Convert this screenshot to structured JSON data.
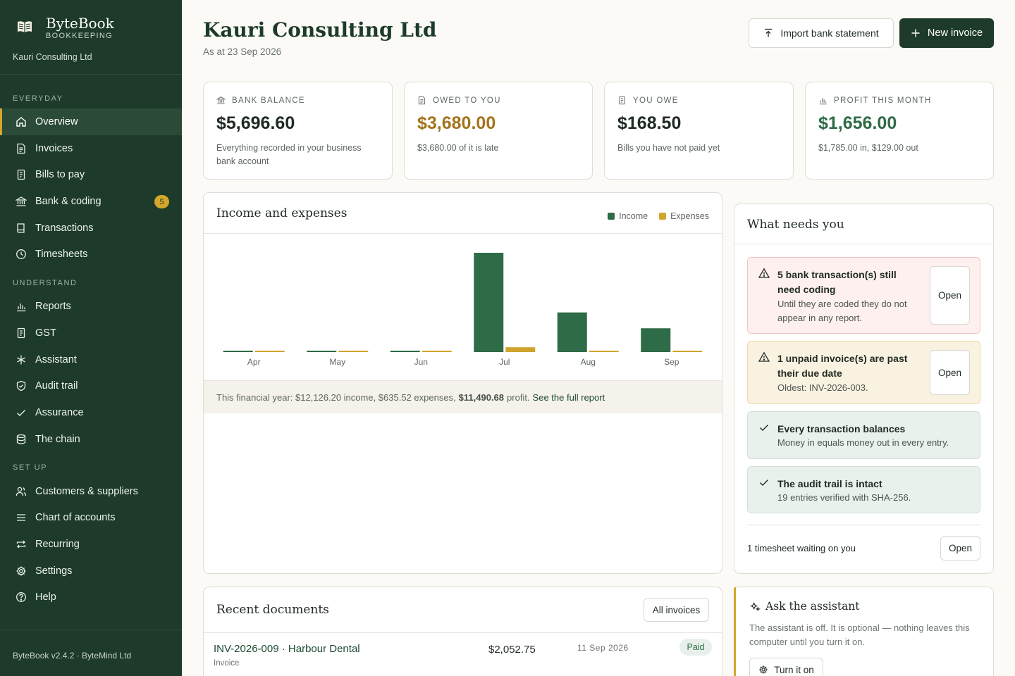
{
  "app": {
    "name": "ByteBook",
    "subtitle": "BOOKKEEPING",
    "company": "Kauri Consulting Ltd",
    "version": "ByteBook v2.4.2 · ByteMind Ltd"
  },
  "sidebar": {
    "sections": [
      {
        "label": "EVERYDAY",
        "items": [
          {
            "label": "Overview",
            "icon": "home-icon",
            "active": true
          },
          {
            "label": "Invoices",
            "icon": "document-icon"
          },
          {
            "label": "Bills to pay",
            "icon": "receipt-icon"
          },
          {
            "label": "Bank & coding",
            "icon": "bank-icon",
            "badge": "5"
          },
          {
            "label": "Transactions",
            "icon": "book-icon"
          },
          {
            "label": "Timesheets",
            "icon": "clock-icon"
          }
        ]
      },
      {
        "label": "UNDERSTAND",
        "items": [
          {
            "label": "Reports",
            "icon": "bar-chart-icon"
          },
          {
            "label": "GST",
            "icon": "receipt-icon"
          },
          {
            "label": "Assistant",
            "icon": "sparkle-icon"
          },
          {
            "label": "Audit trail",
            "icon": "shield-icon"
          },
          {
            "label": "Assurance",
            "icon": "check-icon"
          },
          {
            "label": "The chain",
            "icon": "database-icon"
          }
        ]
      },
      {
        "label": "SET UP",
        "items": [
          {
            "label": "Customers & suppliers",
            "icon": "users-icon"
          },
          {
            "label": "Chart of accounts",
            "icon": "list-icon"
          },
          {
            "label": "Recurring",
            "icon": "repeat-icon"
          },
          {
            "label": "Settings",
            "icon": "gear-icon"
          },
          {
            "label": "Help",
            "icon": "help-icon"
          }
        ]
      }
    ]
  },
  "header": {
    "title": "Kauri Consulting Ltd",
    "subtitle": "As at 23 Sep 2026",
    "import_label": "Import bank statement",
    "new_invoice_label": "New invoice"
  },
  "stats": [
    {
      "label": "BANK BALANCE",
      "value": "$5,696.60",
      "note": "Everything recorded in your business bank account",
      "color": "#1f2a22",
      "icon": "bank-icon"
    },
    {
      "label": "OWED TO YOU",
      "value": "$3,680.00",
      "note": "$3,680.00 of it is late",
      "color": "#a3741d",
      "icon": "document-icon"
    },
    {
      "label": "YOU OWE",
      "value": "$168.50",
      "note": "Bills you have not paid yet",
      "color": "#1f2a22",
      "icon": "receipt-icon"
    },
    {
      "label": "PROFIT THIS MONTH",
      "value": "$1,656.00",
      "note": "$1,785.00 in, $129.00 out",
      "color": "#2f6b47",
      "icon": "bar-chart-icon"
    }
  ],
  "chart_data": {
    "type": "bar",
    "title": "Income and expenses",
    "categories": [
      "Apr",
      "May",
      "Jun",
      "Jul",
      "Aug",
      "Sep"
    ],
    "series": [
      {
        "name": "Income",
        "color": "#2e6b47",
        "values": [
          0,
          0,
          0,
          1440,
          575,
          345
        ]
      },
      {
        "name": "Expenses",
        "color": "#cfa52e",
        "values": [
          0,
          0,
          0,
          70,
          0,
          0
        ]
      }
    ],
    "ylim": [
      0,
      1440
    ],
    "grid": false,
    "legend": "top-right"
  },
  "chart_footer": {
    "text": "This financial year: $12,126.20 income, $635.52 expenses,",
    "profit": "$11,490.68",
    "tail": "profit.",
    "link": "See the full report"
  },
  "needs": {
    "title": "What needs you",
    "alerts": [
      {
        "type": "warning",
        "title": "5 bank transaction(s) still need coding",
        "body": "Until they are coded they do not appear in any report.",
        "button": "Open",
        "bg": "#fdf0ef",
        "border": "#f0c5c2"
      },
      {
        "type": "warning",
        "title": "1 unpaid invoice(s) are past their due date",
        "body": "Oldest: INV-2026-003.",
        "button": "Open",
        "bg": "#faf2e1",
        "border": "#ecd9a8"
      },
      {
        "type": "ok",
        "title": "Every transaction balances",
        "body": "Money in equals money out in every entry.",
        "bg": "#e9f1ec",
        "border": "#d2e1d7"
      },
      {
        "type": "ok",
        "title": "The audit trail is intact",
        "body": "19 entries verified with SHA-256.",
        "bg": "#e9f1ec",
        "border": "#d2e1d7"
      }
    ],
    "timesheet_text": "1 timesheet waiting on you",
    "timesheet_button": "Open"
  },
  "recent": {
    "title": "Recent documents",
    "all_button": "All invoices",
    "rows": [
      {
        "title": "INV-2026-009 · Harbour Dental",
        "type": "Invoice",
        "amount": "$2,052.75",
        "date": "11 Sep 2026",
        "status": "Paid"
      }
    ]
  },
  "assistant": {
    "title": "Ask the assistant",
    "body": "The assistant is off. It is optional — nothing leaves this computer until you turn it on.",
    "button": "Turn it on"
  }
}
